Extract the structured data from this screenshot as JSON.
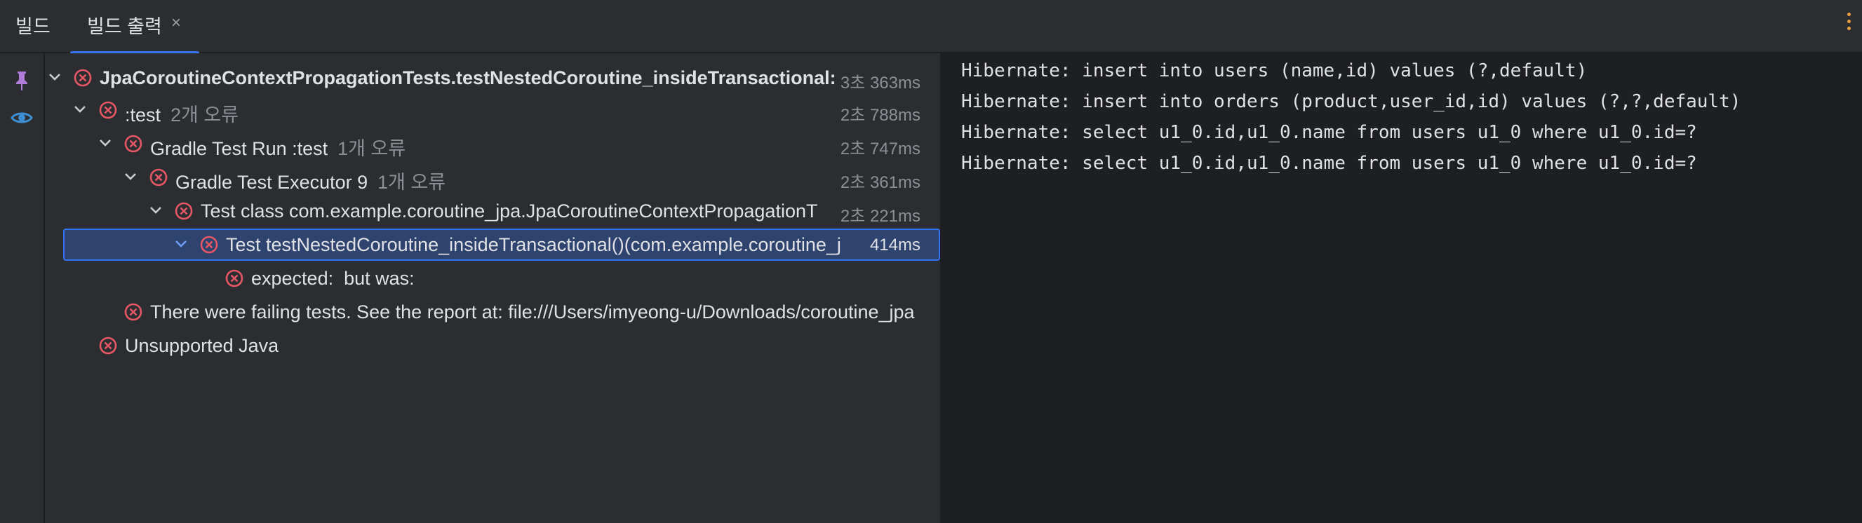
{
  "tabs": {
    "build_label": "빌드",
    "output_label": "빌드 출력",
    "close_glyph": "×"
  },
  "tree": {
    "rows": [
      {
        "label": "JpaCoroutineContextPropagationTests.testNestedCoroutine_insideTransactional:",
        "sub": "",
        "time": "3초 363ms"
      },
      {
        "label": ":test",
        "sub": "2개 오류",
        "time": "2초 788ms"
      },
      {
        "label": "Gradle Test Run :test",
        "sub": "1개 오류",
        "time": "2초 747ms"
      },
      {
        "label": "Gradle Test Executor 9",
        "sub": "1개 오류",
        "time": "2초 361ms"
      },
      {
        "label": "Test class com.example.coroutine_jpa.JpaCoroutineContextPropagationT",
        "sub": "",
        "time": "2초 221ms"
      },
      {
        "label": "Test testNestedCoroutine_insideTransactional()(com.example.coroutine_j",
        "sub": "",
        "time": "414ms"
      },
      {
        "label": "expected:  but was:",
        "sub": "",
        "time": ""
      },
      {
        "label": "There were failing tests. See the report at: file:///Users/imyeong-u/Downloads/coroutine_jpa",
        "sub": "",
        "time": ""
      },
      {
        "label": "Unsupported Java",
        "sub": "",
        "time": ""
      }
    ]
  },
  "console": {
    "lines": [
      "Hibernate: insert into users (name,id) values (?,default)",
      "Hibernate: insert into orders (product,user_id,id) values (?,?,default)",
      "Hibernate: select u1_0.id,u1_0.name from users u1_0 where u1_0.id=?",
      "Hibernate: select u1_0.id,u1_0.name from users u1_0 where u1_0.id=?"
    ]
  },
  "colors": {
    "error": "#e55765",
    "accent": "#3574f0",
    "pin": "#b07cd8",
    "eye": "#3d8fd1"
  },
  "icons": {
    "pin": "pin-icon",
    "eye": "eye-icon",
    "more": "more-vertical-icon",
    "error": "error-circle-icon",
    "chevron": "chevron-down-icon"
  }
}
